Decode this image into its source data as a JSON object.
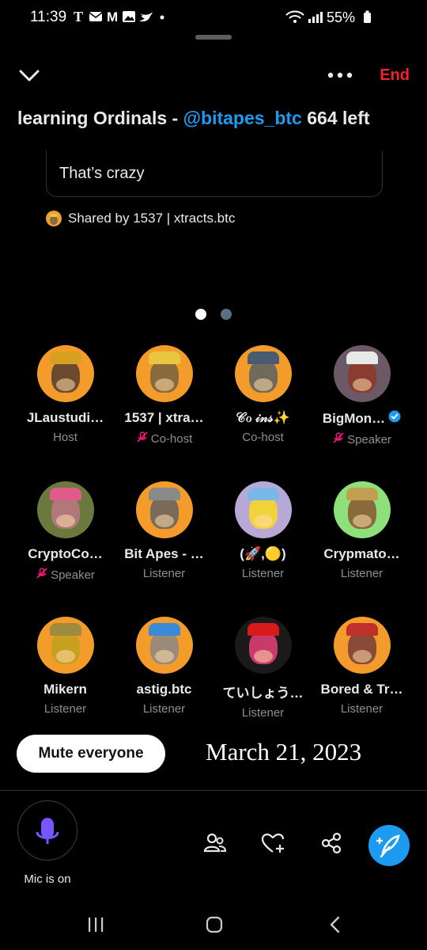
{
  "status_bar": {
    "time": "11:39",
    "left_icons": [
      "tmobile-icon",
      "mail-icon",
      "gmail-icon",
      "gallery-icon",
      "twitter-icon",
      "dot-icon"
    ],
    "battery": "55%"
  },
  "header": {
    "end_label": "End",
    "title_prefix": "learning Ordinals - ",
    "title_handle": "@bitapes_btc",
    "title_suffix": " 664 left"
  },
  "tweet": {
    "text": "That’s crazy",
    "shared_by": "Shared by 1537 | xtracts.btc"
  },
  "pager": {
    "count": 2,
    "active": 0
  },
  "participants": [
    {
      "name": "JLaustudi…",
      "role": "Host",
      "muted": false,
      "verified": false,
      "bg": "#f39b2b",
      "face": "#6b4a2e",
      "hat": "#d8a020"
    },
    {
      "name": "1537 | xtra…",
      "role": "Co-host",
      "muted": true,
      "verified": false,
      "bg": "#f39b2b",
      "face": "#8a6a3c",
      "hat": "#e8c640"
    },
    {
      "name": "𝒞ℴ 𝒾𝓃𝓈✨",
      "role": "Co-host",
      "muted": false,
      "verified": false,
      "bg": "#f39b2b",
      "face": "#6f6a5c",
      "hat": "#4a5a70"
    },
    {
      "name": "BigMon…",
      "role": "Speaker",
      "muted": true,
      "verified": true,
      "bg": "#6b5a66",
      "face": "#8a3c30",
      "hat": "#e8e8e8"
    },
    {
      "name": "CryptoCo…",
      "role": "Speaker",
      "muted": true,
      "verified": false,
      "bg": "#6b7a3c",
      "face": "#b0787a",
      "hat": "#e05a8a"
    },
    {
      "name": "Bit Apes - …",
      "role": "Listener",
      "muted": false,
      "verified": false,
      "bg": "#f39b2b",
      "face": "#7a6a5a",
      "hat": "#8a8a8a"
    },
    {
      "name": "(🚀,🟡)",
      "role": "Listener",
      "muted": false,
      "verified": false,
      "bg": "#b8a8d8",
      "face": "#f2d23a",
      "hat": "#7ab8e8"
    },
    {
      "name": "Crypmato…",
      "role": "Listener",
      "muted": false,
      "verified": false,
      "bg": "#8ee07a",
      "face": "#8a6a3c",
      "hat": "#c0a050"
    },
    {
      "name": "Mikern",
      "role": "Listener",
      "muted": false,
      "verified": false,
      "bg": "#f39b2b",
      "face": "#c8a020",
      "hat": "#a08a40"
    },
    {
      "name": "astig.btc",
      "role": "Listener",
      "muted": false,
      "verified": false,
      "bg": "#f39b2b",
      "face": "#9a8a7a",
      "hat": "#3a8ad8"
    },
    {
      "name": "ていしょう…",
      "role": "Listener",
      "muted": false,
      "verified": false,
      "bg": "#1a1a1a",
      "face": "#c83a6a",
      "hat": "#d81a1a"
    },
    {
      "name": "Bored & Tr…",
      "role": "Listener",
      "muted": false,
      "verified": false,
      "bg": "#f39b2b",
      "face": "#8a4a3a",
      "hat": "#c0302a"
    }
  ],
  "controls": {
    "mute_everyone": "Mute everyone",
    "date_overlay": "March 21, 2023",
    "mic_label": "Mic is on"
  },
  "colors": {
    "accent_blue": "#1d9bf0",
    "end_red": "#f4212e",
    "mic_purple": "#7856ff",
    "muted_pink": "#f91880"
  }
}
